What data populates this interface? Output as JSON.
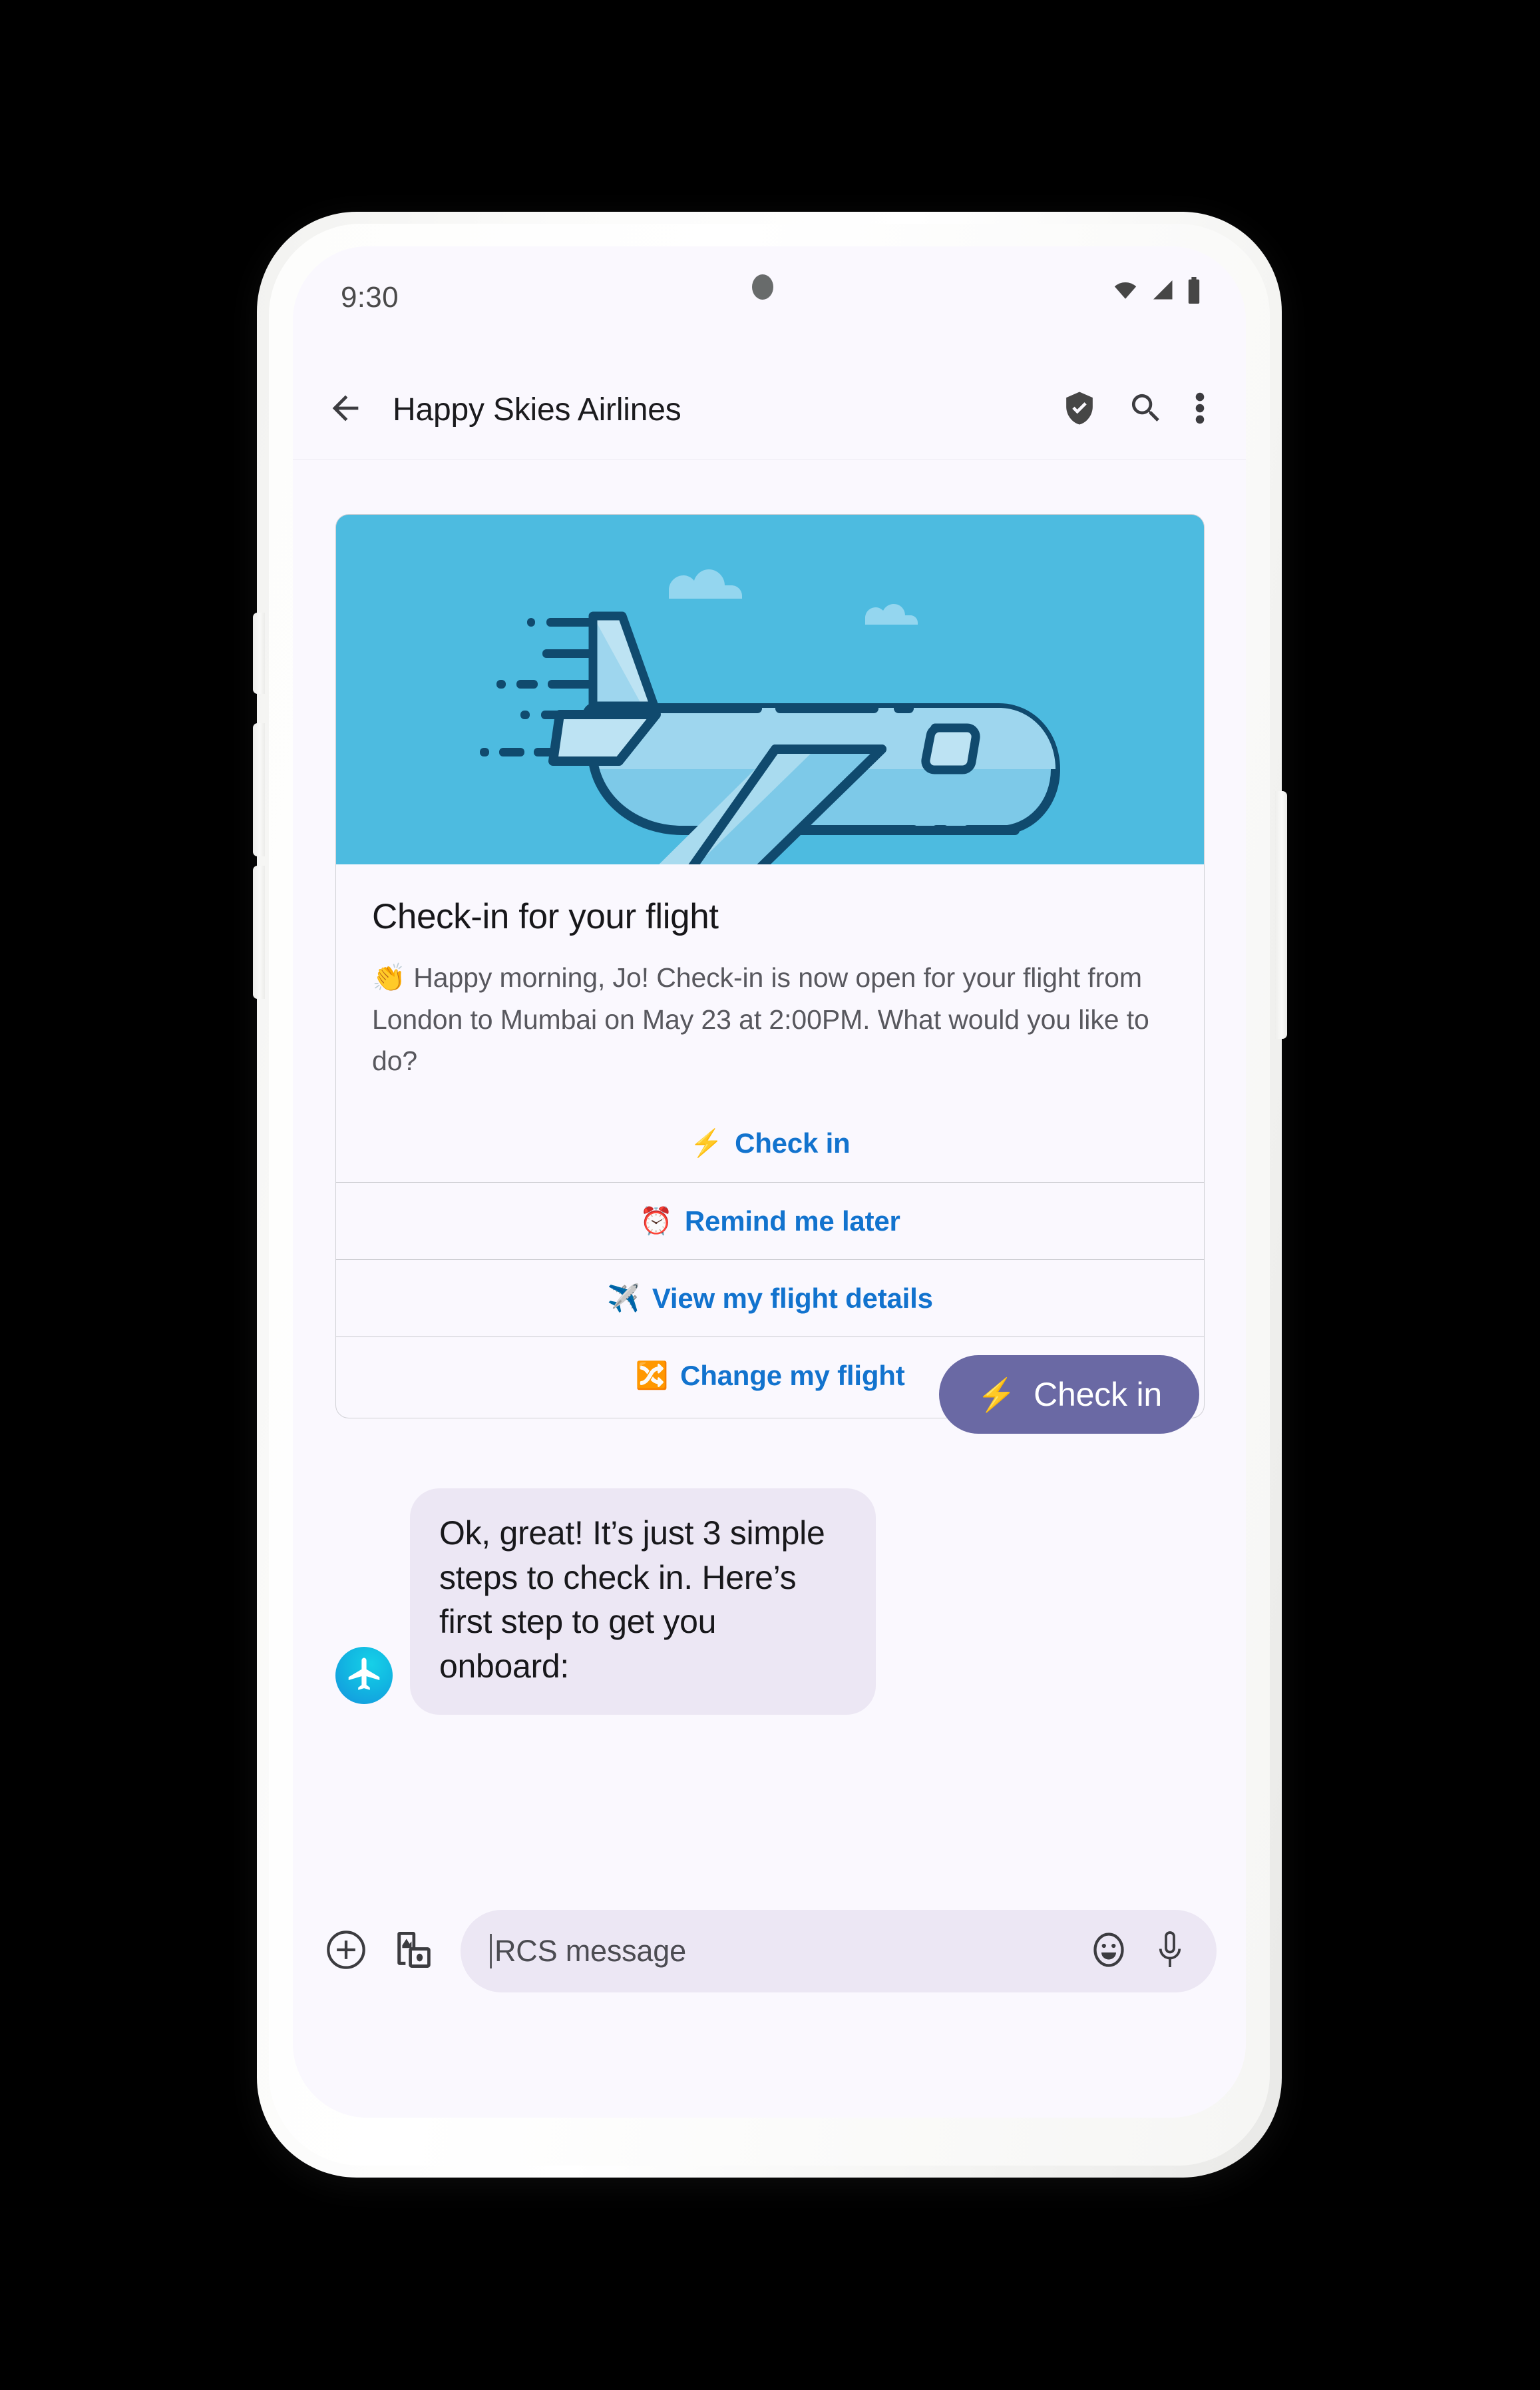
{
  "phone": {
    "side_buttons": [
      "mute-switch",
      "volume-up",
      "volume-down",
      "power"
    ]
  },
  "status_bar": {
    "time": "9:30",
    "icons": [
      "wifi-icon",
      "cellular-signal-icon",
      "battery-icon"
    ],
    "camera": "front-camera-punch-hole"
  },
  "appbar": {
    "back_icon": "back-arrow-icon",
    "title": "Happy Skies Airlines",
    "actions": [
      {
        "name": "verified-shield-icon",
        "label": "Verified business"
      },
      {
        "name": "search-icon",
        "label": "Search"
      },
      {
        "name": "overflow-menu-icon",
        "label": "More options"
      }
    ]
  },
  "card": {
    "hero_alt": "airplane-illustration",
    "hero_bg": "#4dbbe0",
    "title": "Check-in for your flight",
    "description": "👏 Happy morning, Jo! Check-in is now open for your flight from London to Mumbai on May 23 at 2:00PM. What would you like to do?",
    "actions": [
      {
        "emoji": "⚡",
        "label": "Check in"
      },
      {
        "emoji": "⏰",
        "label": "Remind me later"
      },
      {
        "emoji": "✈️",
        "label": "View my flight details"
      },
      {
        "emoji": "🔀",
        "label": "Change my flight"
      }
    ],
    "action_color": "#1273ce"
  },
  "messages": {
    "sent": {
      "emoji": "⚡",
      "text": "Check in",
      "bubble_color": "#6a69a4",
      "text_color": "#ffffff"
    },
    "received": {
      "avatar": "airline-avatar-icon",
      "text": "Ok, great! It’s just 3 simple steps to check in. Here’s first step to get you onboard:",
      "bubble_color": "#ece7f4"
    }
  },
  "composer": {
    "plus_icon": "add-attachment-icon",
    "gallery_icon": "gallery-camera-icon",
    "placeholder": "RCS message",
    "value": "",
    "emoji_icon": "emoji-icon",
    "mic_icon": "microphone-icon"
  }
}
